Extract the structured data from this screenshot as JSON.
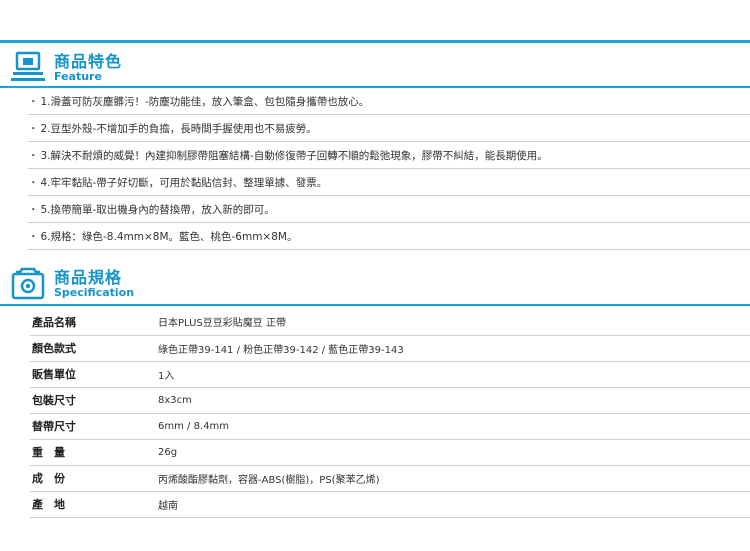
{
  "feature_section": {
    "title_zh": "商品特色",
    "title_en": "Feature",
    "items": [
      "1.滑蓋可防灰塵髒污！-防塵功能佳，放入筆盒、包包隨身攜帶也放心。",
      "2.豆型外殼-不增加手的負擔，長時間手握使用也不易疲勞。",
      "3.解決不耐煩的威覺！內建抑制膠帶阻塞結構-自動修復帶子回轉不順的鬆弛現象，膠帶不糾結，能長期使用。",
      "4.牢牢黏貼-帶子好切斷，可用於黏貼信封、整理單據、發票。",
      "5.換帶簡單-取出機身內的替換帶，放入新的即可。",
      "6.規格：綠色-8.4mm×8M。藍色、桃色-6mm×8M。"
    ]
  },
  "spec_section": {
    "title_zh": "商品規格",
    "title_en": "Specification",
    "rows": [
      {
        "label": "產品名稱",
        "value": "日本PLUS豆豆彩貼魔豆 正帶"
      },
      {
        "label": "顏色款式",
        "value": "綠色正帶39-141 / 粉色正帶39-142 / 藍色正帶39-143"
      },
      {
        "label": "販售單位",
        "value": "1入"
      },
      {
        "label": "包裝尺寸",
        "value": "8x3cm"
      },
      {
        "label": "替帶尺寸",
        "value": "6mm / 8.4mm"
      },
      {
        "label": "重　量",
        "value": "26g"
      },
      {
        "label": "成　份",
        "value": "丙烯酸酯膠黏劑，容器-ABS(樹脂)，PS(聚苯乙烯)"
      },
      {
        "label": "產　地",
        "value": "越南"
      }
    ]
  },
  "colors": {
    "accent": "#1594cc",
    "rule": "#1aa3dc",
    "divider": "#cfcfcf"
  },
  "icons": {
    "feature": "monitor-icon",
    "spec": "camera-icon"
  }
}
